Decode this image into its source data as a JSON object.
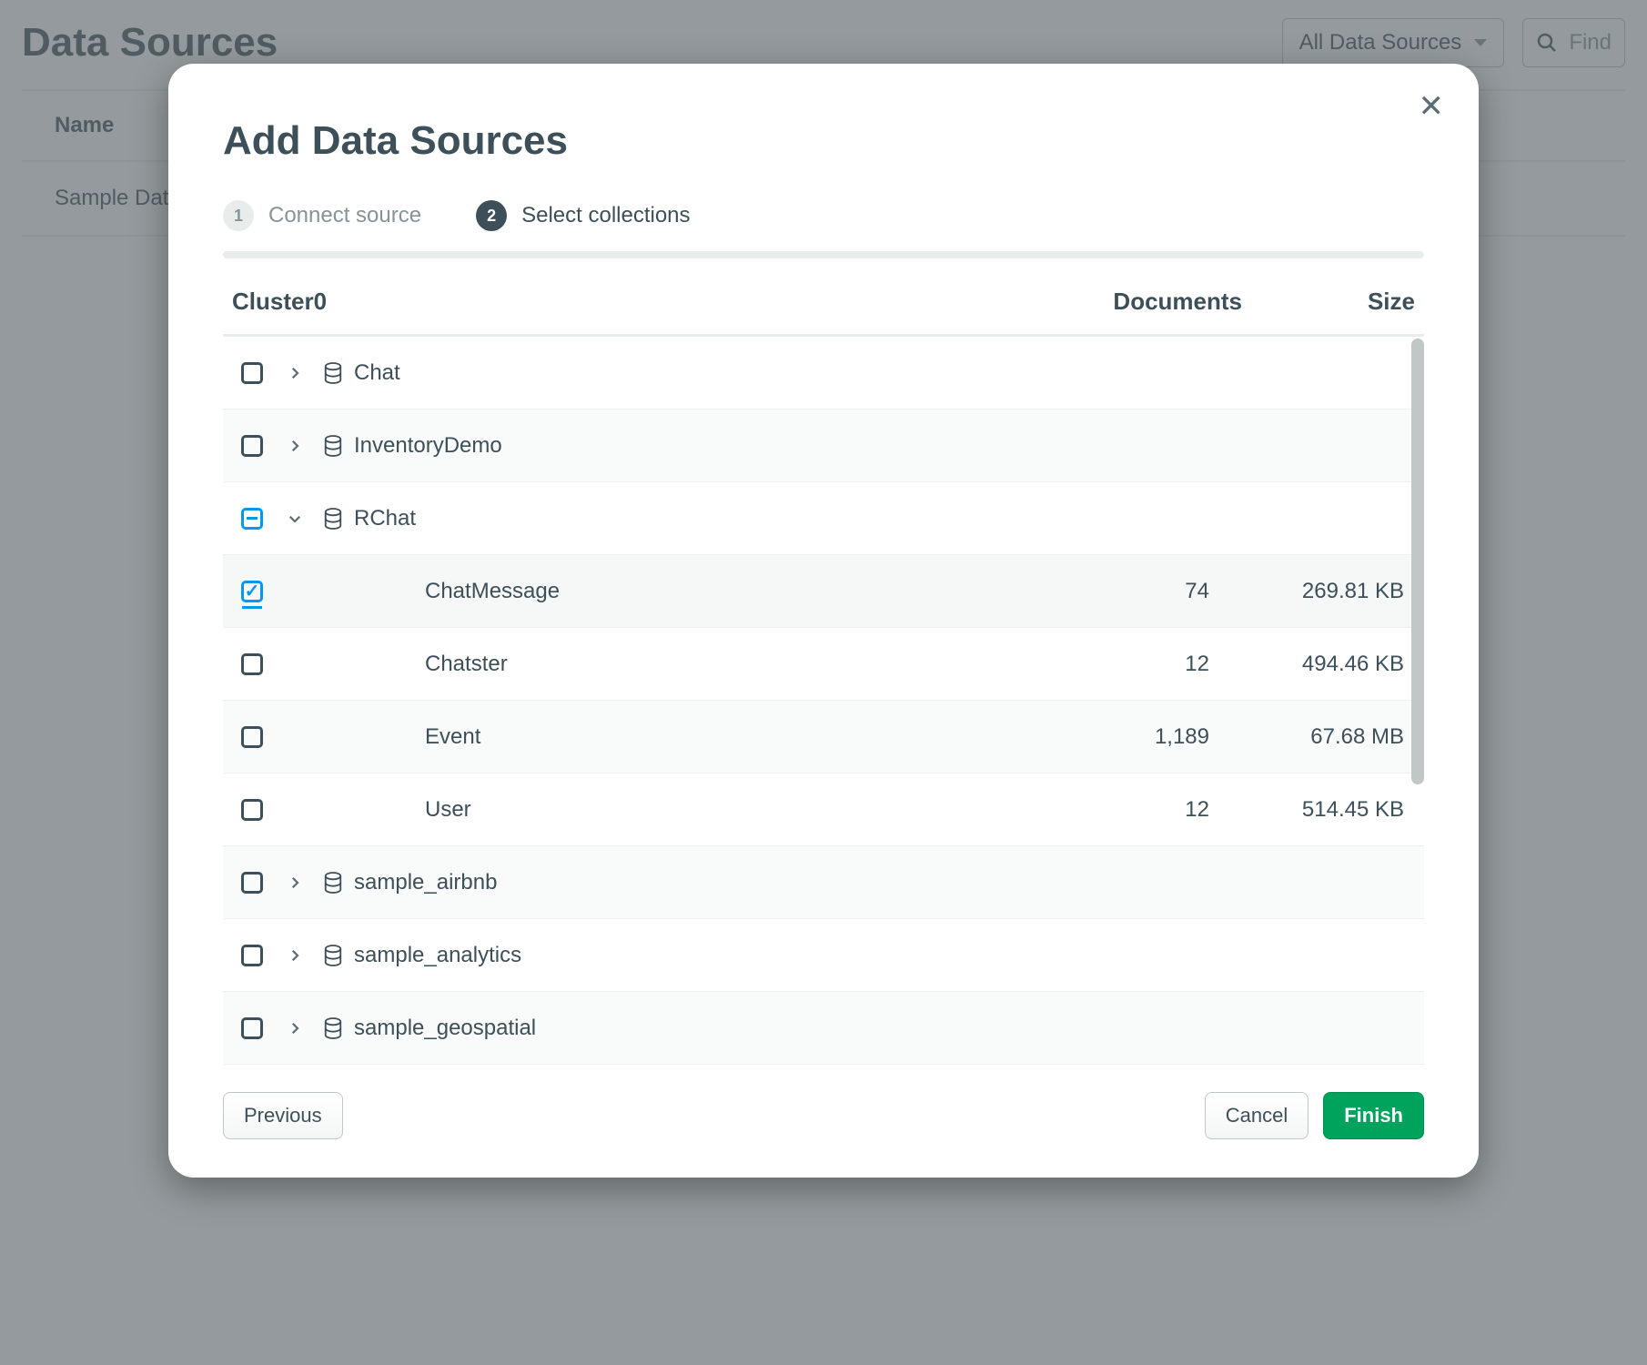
{
  "bg": {
    "title": "Data Sources",
    "filter_label": "All Data Sources",
    "search_placeholder": "Find",
    "col_name": "Name",
    "row1": "Sample Data"
  },
  "modal": {
    "title": "Add Data Sources",
    "step1_num": "1",
    "step1_label": "Connect source",
    "step2_num": "2",
    "step2_label": "Select collections",
    "cluster": "Cluster0",
    "col_documents": "Documents",
    "col_size": "Size",
    "rows": {
      "chat": "Chat",
      "inventory": "InventoryDemo",
      "rchat": "RChat",
      "chatmessage": {
        "name": "ChatMessage",
        "docs": "74",
        "size": "269.81 KB"
      },
      "chatster": {
        "name": "Chatster",
        "docs": "12",
        "size": "494.46 KB"
      },
      "event": {
        "name": "Event",
        "docs": "1,189",
        "size": "67.68 MB"
      },
      "user": {
        "name": "User",
        "docs": "12",
        "size": "514.45 KB"
      },
      "airbnb": "sample_airbnb",
      "analytics": "sample_analytics",
      "geospatial": "sample_geospatial"
    },
    "btn_previous": "Previous",
    "btn_cancel": "Cancel",
    "btn_finish": "Finish"
  }
}
